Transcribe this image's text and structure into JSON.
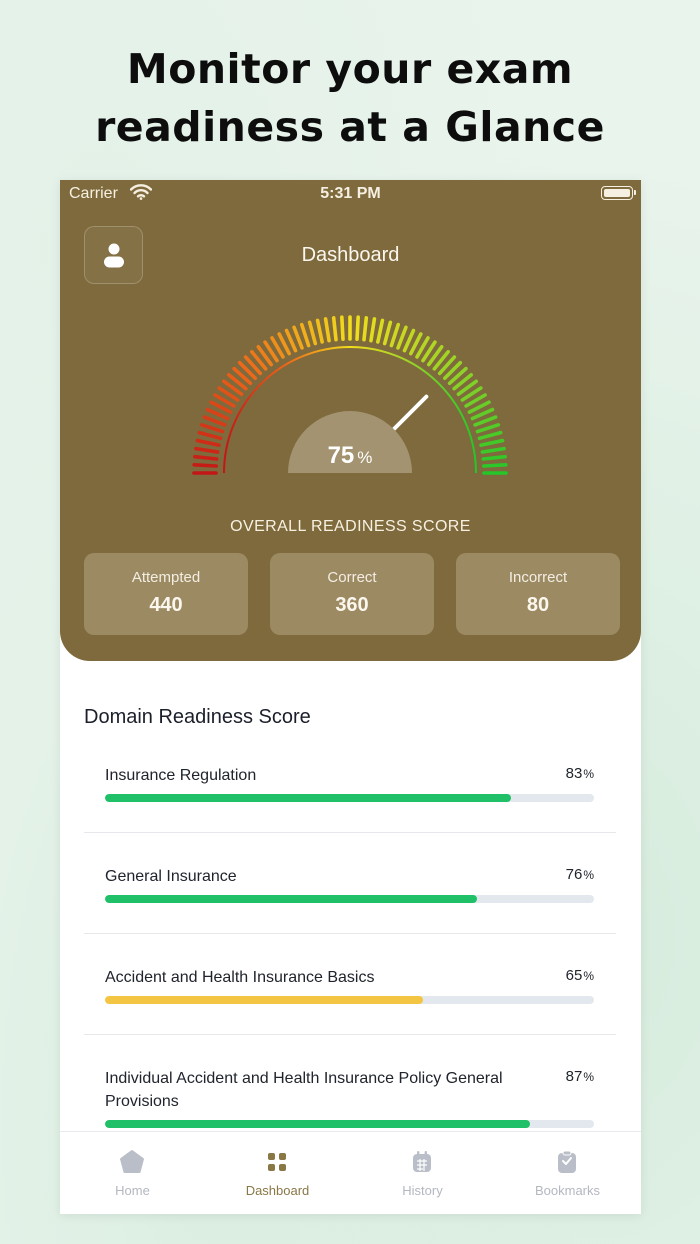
{
  "headline": {
    "line1": "Monitor your exam",
    "line2": "readiness at a Glance"
  },
  "status_bar": {
    "carrier": "Carrier",
    "time": "5:31 PM"
  },
  "header": {
    "title": "Dashboard"
  },
  "gauge": {
    "value": "75",
    "unit": "%",
    "fraction": 0.75,
    "label": "OVERALL READINESS SCORE"
  },
  "stats": [
    {
      "label": "Attempted",
      "value": "440"
    },
    {
      "label": "Correct",
      "value": "360"
    },
    {
      "label": "Incorrect",
      "value": "80"
    }
  ],
  "domains_title": "Domain Readiness Score",
  "domains": [
    {
      "name": "Insurance Regulation",
      "percent": "83",
      "unit": "%",
      "fraction": 0.83,
      "color": "#1fc067"
    },
    {
      "name": "General Insurance",
      "percent": "76",
      "unit": "%",
      "fraction": 0.76,
      "color": "#1fc067"
    },
    {
      "name": "Accident and Health Insurance Basics",
      "percent": "65",
      "unit": "%",
      "fraction": 0.65,
      "color": "#f4c542"
    },
    {
      "name": "Individual Accident and Health Insurance Policy General Provisions",
      "percent": "87",
      "unit": "%",
      "fraction": 0.87,
      "color": "#1fc067"
    }
  ],
  "nav": [
    {
      "label": "Home",
      "icon": "home-icon"
    },
    {
      "label": "Dashboard",
      "icon": "dashboard-grid-icon",
      "active": true
    },
    {
      "label": "History",
      "icon": "history-icon"
    },
    {
      "label": "Bookmarks",
      "icon": "bookmarks-icon"
    }
  ],
  "colors": {
    "brand": "#7e6a3c",
    "card": "#9c8a63",
    "accent_green": "#1fc067",
    "accent_yellow": "#f4c542"
  }
}
